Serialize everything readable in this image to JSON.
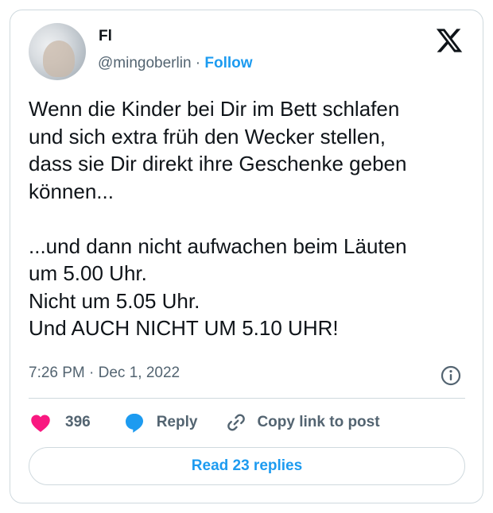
{
  "author": {
    "name": "Fl",
    "handle": "@mingoberlin",
    "separator": " · ",
    "follow_label": "Follow"
  },
  "tweet": {
    "text": "Wenn die Kinder bei Dir im Bett schlafen\nund sich extra früh den Wecker stellen,\ndass sie Dir direkt ihre Geschenke geben\nkönnen...\n\n...und dann nicht aufwachen beim Läuten\num 5.00 Uhr.\nNicht um 5.05 Uhr.\nUnd AUCH NICHT UM 5.10 UHR!",
    "timestamp": "7:26 PM · Dec 1, 2022"
  },
  "actions": {
    "like_count": "396",
    "reply_label": "Reply",
    "copy_label": "Copy link to post"
  },
  "read_replies_label": "Read 23 replies",
  "colors": {
    "accent": "#1d9bf0",
    "like": "#f91880",
    "text": "#0f1419",
    "muted": "#536471",
    "border": "#cfd9de"
  },
  "icons": [
    "x-logo-icon",
    "info-icon",
    "heart-icon",
    "reply-bubble-icon",
    "link-icon"
  ]
}
